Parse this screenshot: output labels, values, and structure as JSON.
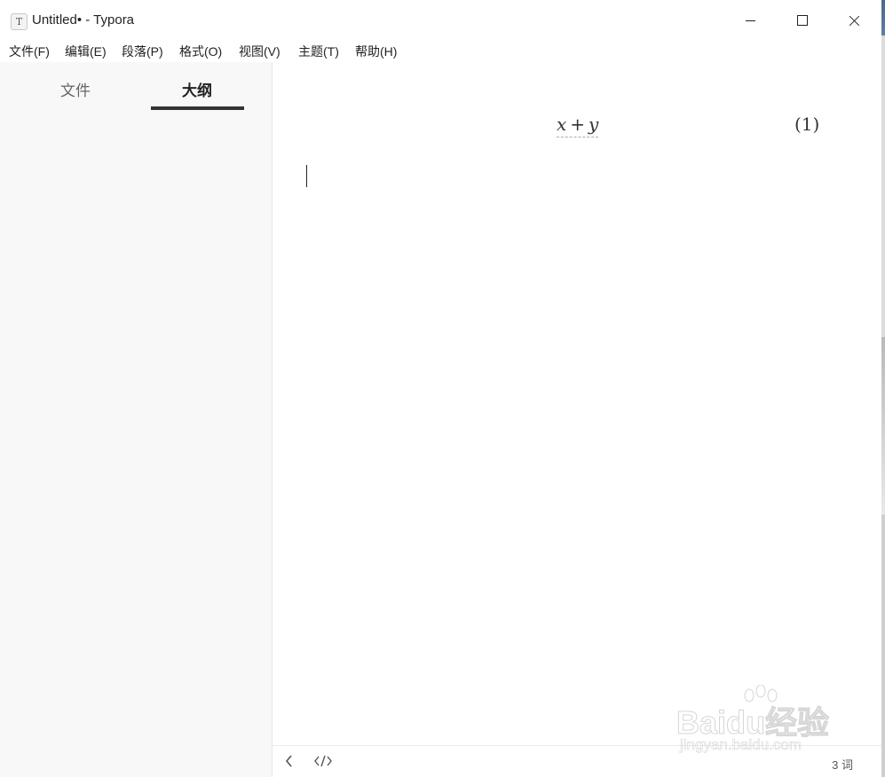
{
  "window": {
    "app_icon_letter": "T",
    "title": "Untitled• - Typora"
  },
  "menu": [
    "文件(F)",
    "编辑(E)",
    "段落(P)",
    "格式(O)",
    "视图(V)",
    "主题(T)",
    "帮助(H)"
  ],
  "sidebar": {
    "tabs": [
      {
        "label": "文件",
        "active": false
      },
      {
        "label": "大纲",
        "active": true
      }
    ]
  },
  "editor": {
    "math": {
      "left": "x",
      "operator": "+",
      "right": "y",
      "equation_number": "(1)"
    }
  },
  "statusbar": {
    "back_icon": "chevron-left-icon",
    "source_icon": "code-icon",
    "word_count": "3 词"
  },
  "watermark": {
    "main": "Baidu经验",
    "sub": "jingyan.baidu.com"
  }
}
